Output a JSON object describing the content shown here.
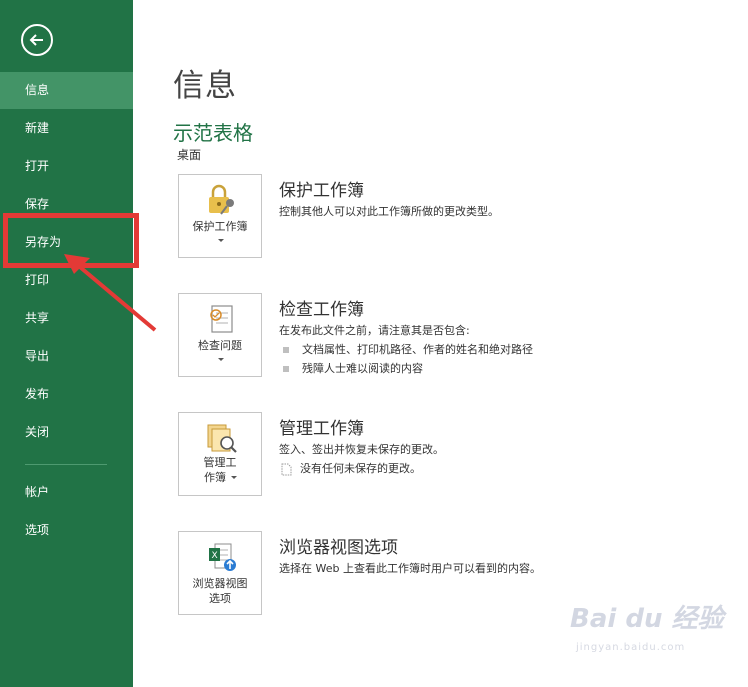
{
  "sidebar": {
    "items": [
      {
        "label": "信息",
        "active": true
      },
      {
        "label": "新建"
      },
      {
        "label": "打开"
      },
      {
        "label": "保存"
      },
      {
        "label": "另存为"
      },
      {
        "label": "打印"
      },
      {
        "label": "共享"
      },
      {
        "label": "导出"
      },
      {
        "label": "发布"
      },
      {
        "label": "关闭"
      },
      {
        "label": "帐户"
      },
      {
        "label": "选项"
      }
    ],
    "back_icon": "back-arrow-icon"
  },
  "main": {
    "title": "信息",
    "doc_name": "示范表格",
    "doc_location": "桌面",
    "sections": [
      {
        "card_label": "保护工作簿",
        "title": "保护工作簿",
        "description": "控制其他人可以对此工作簿所做的更改类型。"
      },
      {
        "card_label": "检查问题",
        "title": "检查工作簿",
        "description": "在发布此文件之前，请注意其是否包含:",
        "bullets": [
          "文档属性、打印机路径、作者的姓名和绝对路径",
          "残障人士难以阅读的内容"
        ]
      },
      {
        "card_label_line1": "管理工",
        "card_label_line2": "作簿",
        "title": "管理工作簿",
        "description": "签入、签出并恢复未保存的更改。",
        "note": "没有任何未保存的更改。"
      },
      {
        "card_label_line1": "浏览器视图",
        "card_label_line2": "选项",
        "title": "浏览器视图选项",
        "description": "选择在 Web 上查看此工作簿时用户可以看到的内容。"
      }
    ]
  },
  "watermark": {
    "main": "Bai du 经验",
    "sub": "jingyan.baidu.com"
  },
  "colors": {
    "sidebar_bg": "#217346",
    "sidebar_active": "#439467",
    "accent_green": "#217346",
    "annotation_red": "#e33a36"
  }
}
